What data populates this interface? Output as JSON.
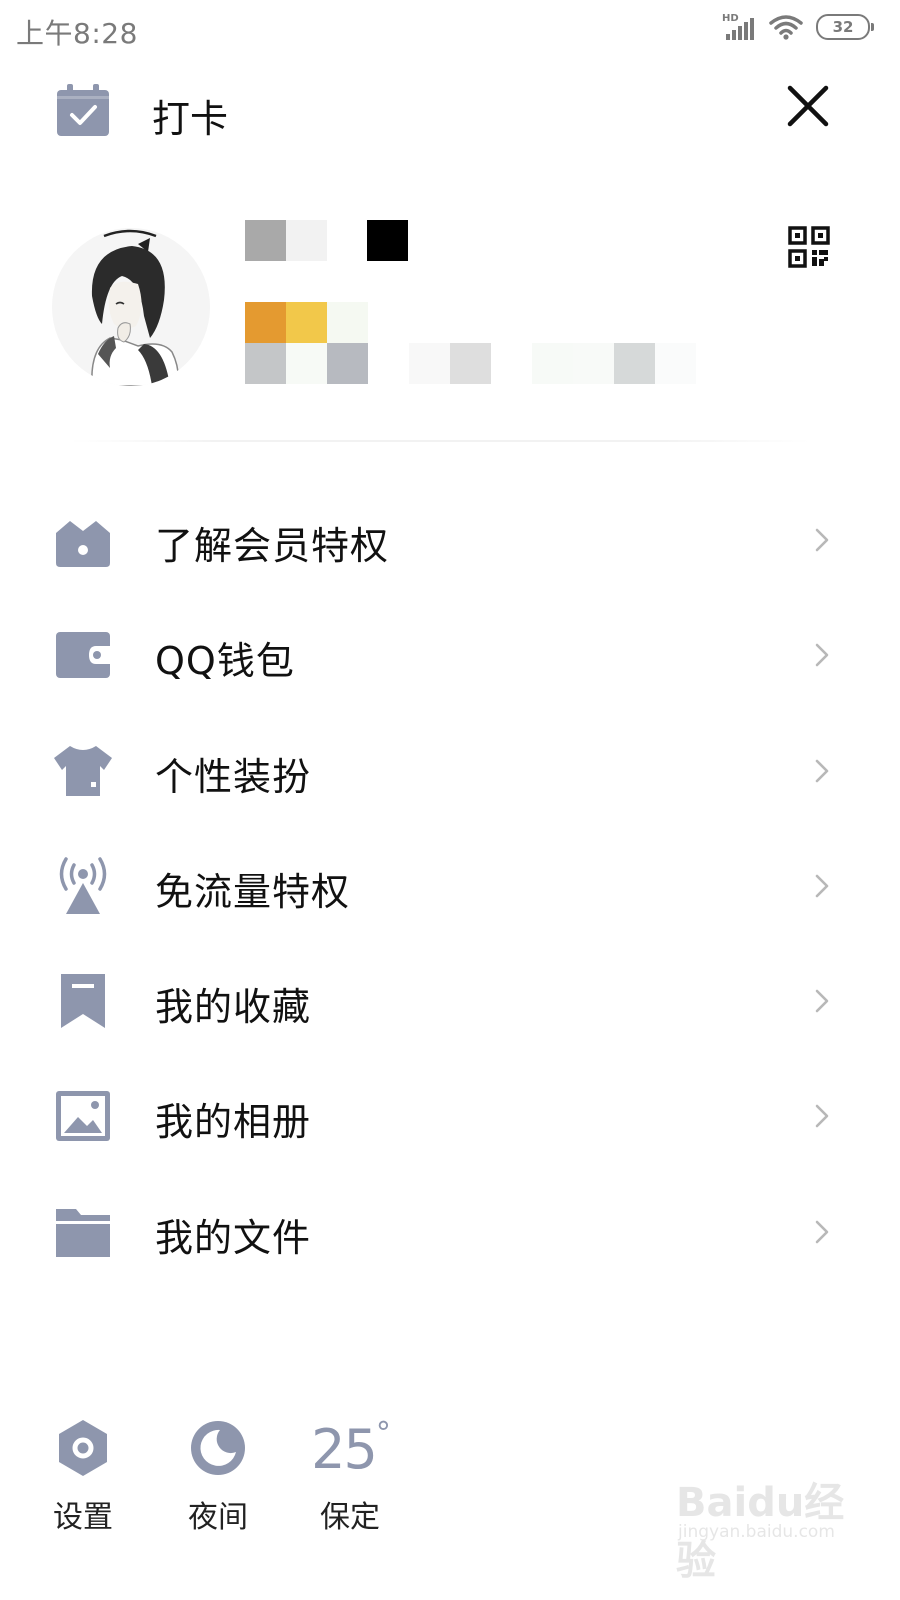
{
  "status_bar": {
    "time": "上午8:28",
    "network_label": "HD",
    "battery_level": "32",
    "icons": [
      "signal-icon",
      "wifi-icon",
      "battery-icon"
    ]
  },
  "header": {
    "checkin_label": "打卡",
    "checkin_icon": "calendar-check-icon",
    "close_icon": "close-icon"
  },
  "profile": {
    "avatar_icon": "avatar",
    "qr_icon": "qr-code-icon",
    "name_redacted": true,
    "signature_redacted": true
  },
  "menu": {
    "items": [
      {
        "label": "了解会员特权",
        "icon": "vip-crown-icon"
      },
      {
        "label": "QQ钱包",
        "icon": "wallet-icon"
      },
      {
        "label": "个性装扮",
        "icon": "tshirt-icon"
      },
      {
        "label": "免流量特权",
        "icon": "antenna-icon"
      },
      {
        "label": "我的收藏",
        "icon": "bookmark-icon"
      },
      {
        "label": "我的相册",
        "icon": "photo-icon"
      },
      {
        "label": "我的文件",
        "icon": "folder-icon"
      }
    ]
  },
  "bottom_bar": {
    "settings_label": "设置",
    "night_label": "夜间",
    "weather_temp": "25",
    "weather_unit": "°",
    "weather_city": "保定"
  },
  "watermark": {
    "main": "Baidu经验",
    "sub": "jingyan.baidu.com"
  },
  "colors": {
    "icon_gray": "#8e96ad",
    "text": "#111111",
    "chevron": "#b8b8b8",
    "status": "#7a7a7a"
  }
}
